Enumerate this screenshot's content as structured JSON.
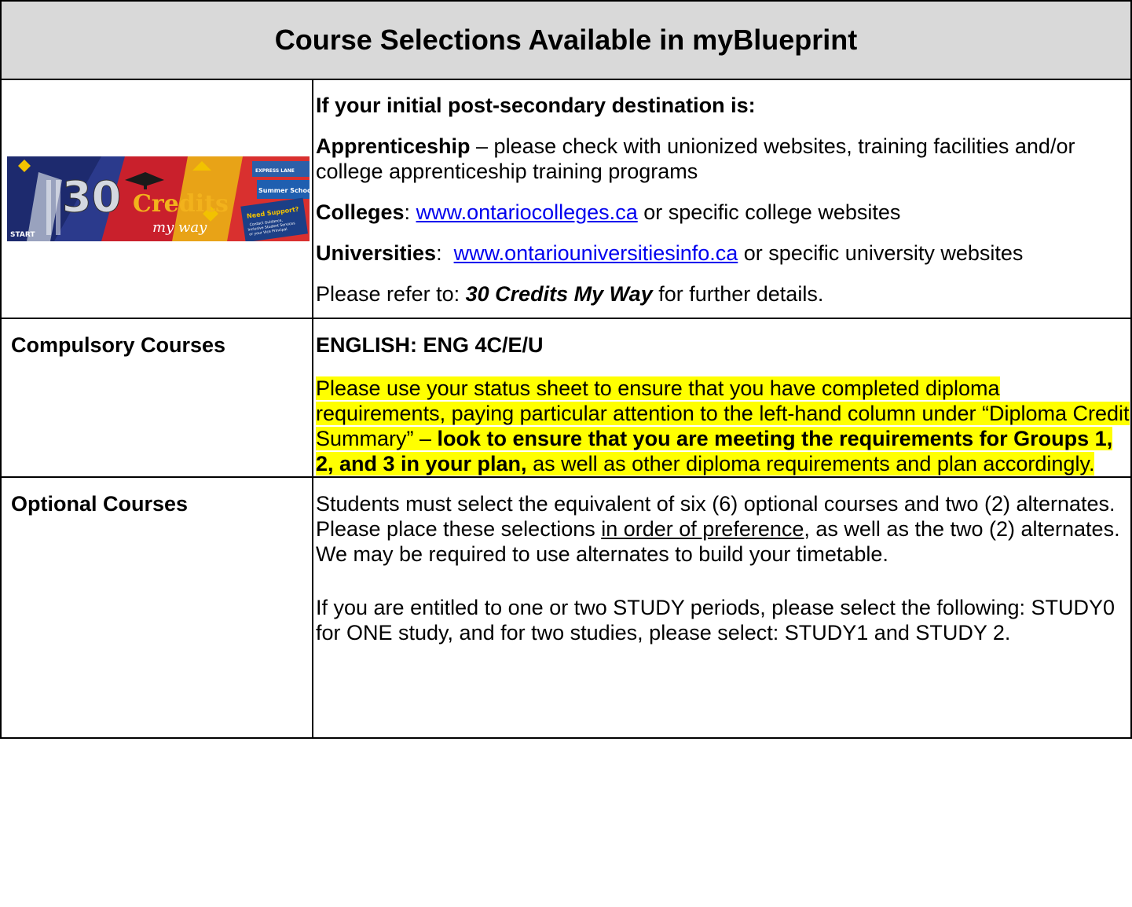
{
  "title": "Course Selections Available in myBlueprint",
  "banner": {
    "big_number": "30",
    "word": "Credits",
    "script": "my way",
    "start": "START",
    "express": "EXPRESS LANE",
    "summer": "Summer School",
    "support_title": "Need Support?",
    "support_l1": "Contact Guidance,",
    "support_l2": "Inclusive Student Services",
    "support_l3": "or your Vice Principal"
  },
  "intro": {
    "heading": "If your initial post-secondary destination is:",
    "apprenticeship_label": "Apprenticeship",
    "apprenticeship_text": " – please check with unionized websites, training facilities and/or college apprenticeship training programs",
    "colleges_label": "Colleges",
    "colleges_sep": ": ",
    "colleges_link": "www.ontariocolleges.ca",
    "colleges_text": " or specific college websites",
    "universities_label": "Universities",
    "universities_sep": ":  ",
    "universities_link": "www.ontariouniversitiesinfo.ca",
    "universities_text": " or specific university websites",
    "refer_pre": "Please refer to: ",
    "refer_title": "30 Credits My Way",
    "refer_post": " for further details."
  },
  "compulsory": {
    "label": "Compulsory Courses",
    "english": "ENGLISH:  ENG 4C/E/U",
    "note_1": "Please use your status sheet to ensure that you have completed diploma requirements, paying particular attention to the left-hand column under “Diploma Credit Summary” – ",
    "note_bold": "look to ensure that you are meeting the requirements for Groups 1, 2, and 3 in your plan,",
    "note_2": " as well as other diploma requirements and plan accordingly."
  },
  "optional": {
    "label": "Optional Courses",
    "p1_a": "Students must select the equivalent of six (6) optional courses and two (2) alternates.  Please place these selections ",
    "p1_u": "in order of preference",
    "p1_b": ", as well as the two (2) alternates.  We may be required to use alternates to build your timetable.",
    "p2": "If you are entitled to one or two STUDY periods, please select the following:  STUDY0 for ONE study, and for two studies, please select: STUDY1 and STUDY 2."
  },
  "colors": {
    "title_bg": "#d9d9d9",
    "highlight": "#ffff00",
    "link": "#0000ee"
  }
}
